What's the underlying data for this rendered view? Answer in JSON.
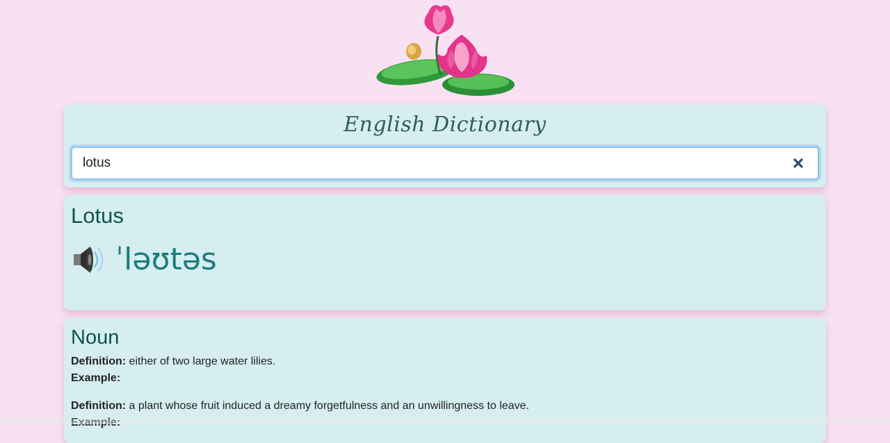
{
  "header": {
    "logo_icon": "lotus-flower-icon"
  },
  "search": {
    "title": "English Dictionary",
    "value": "lotus",
    "clear_icon": "close-icon"
  },
  "word": {
    "headword": "Lotus",
    "phonetic": "ˈləʊtəs",
    "audio_icon": "speaker-icon"
  },
  "meanings": [
    {
      "part_of_speech": "Noun",
      "definitions": [
        {
          "definition_label": "Definition:",
          "definition": "either of two large water lilies.",
          "example_label": "Example:",
          "example": ""
        },
        {
          "definition_label": "Definition:",
          "definition": "a plant whose fruit induced a dreamy forgetfulness and an unwillingness to leave.",
          "example_label": "Example:",
          "example": ""
        }
      ]
    }
  ],
  "colors": {
    "background": "#f7e1f2",
    "card": "#d6eef0",
    "heading": "#0d5450",
    "phonetic": "#1a7d7c"
  }
}
